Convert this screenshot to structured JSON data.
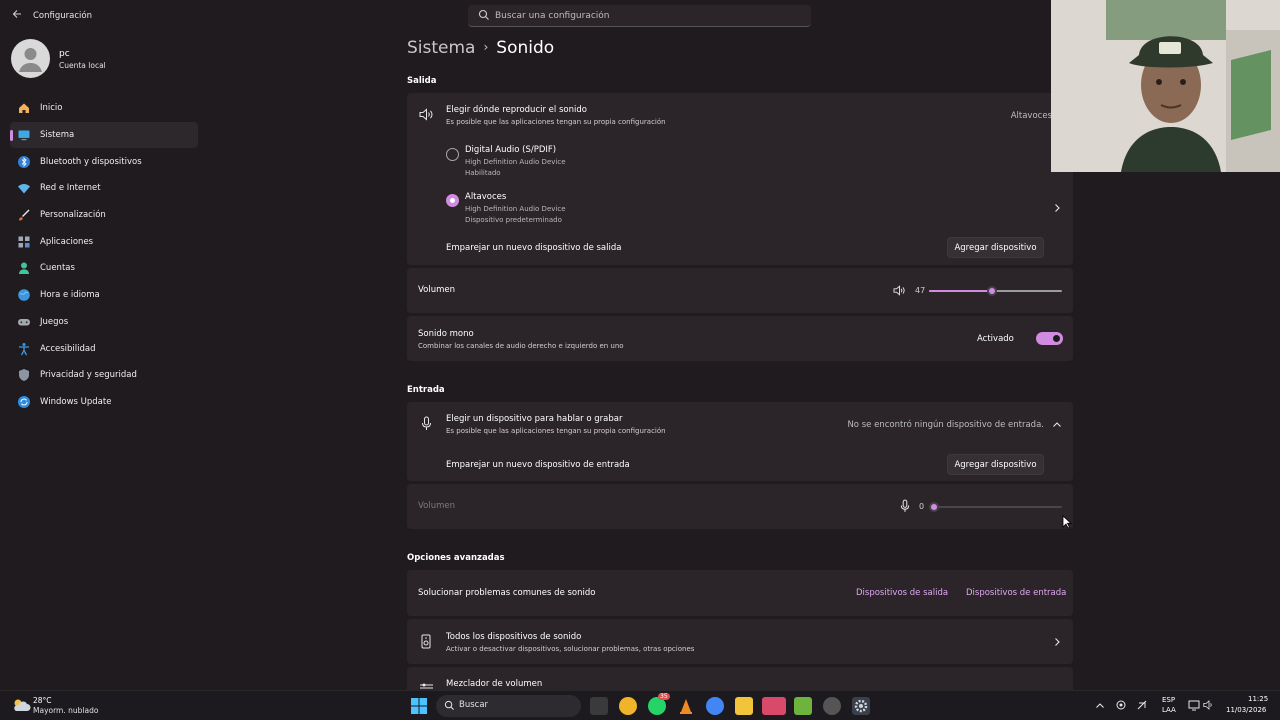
{
  "window": {
    "title": "Configuración"
  },
  "search": {
    "placeholder": "Buscar una configuración"
  },
  "profile": {
    "name": "pc",
    "account_type": "Cuenta local"
  },
  "sidebar": {
    "items": [
      {
        "label": "Inicio",
        "icon": "home-icon"
      },
      {
        "label": "Sistema",
        "icon": "system-icon",
        "active": true
      },
      {
        "label": "Bluetooth y dispositivos",
        "icon": "bluetooth-icon"
      },
      {
        "label": "Red e Internet",
        "icon": "wifi-icon"
      },
      {
        "label": "Personalización",
        "icon": "brush-icon"
      },
      {
        "label": "Aplicaciones",
        "icon": "apps-icon"
      },
      {
        "label": "Cuentas",
        "icon": "accounts-icon"
      },
      {
        "label": "Hora e idioma",
        "icon": "globe-icon"
      },
      {
        "label": "Juegos",
        "icon": "gamepad-icon"
      },
      {
        "label": "Accesibilidad",
        "icon": "accessibility-icon"
      },
      {
        "label": "Privacidad y seguridad",
        "icon": "shield-icon"
      },
      {
        "label": "Windows Update",
        "icon": "update-icon"
      }
    ]
  },
  "breadcrumb": {
    "parent": "Sistema",
    "separator": "›",
    "current": "Sonido"
  },
  "output": {
    "section_title": "Salida",
    "choose": {
      "title": "Elegir dónde reproducir el sonido",
      "subtitle": "Es posible que las aplicaciones tengan su propia configuración",
      "value": "Altavoces"
    },
    "devices": [
      {
        "name": "Digital Audio (S/PDIF)",
        "driver": "High Definition Audio Device",
        "status": "Habilitado",
        "selected": false
      },
      {
        "name": "Altavoces",
        "driver": "High Definition Audio Device",
        "status": "Dispositivo predeterminado",
        "selected": true
      }
    ],
    "pair": {
      "label": "Emparejar un nuevo dispositivo de salida",
      "button": "Agregar dispositivo"
    },
    "volume": {
      "label": "Volumen",
      "value": "47",
      "level": 47
    },
    "mono": {
      "title": "Sonido mono",
      "subtitle": "Combinar los canales de audio derecho e izquierdo en uno",
      "state": "Activado",
      "on": true
    }
  },
  "input": {
    "section_title": "Entrada",
    "choose": {
      "title": "Elegir un dispositivo para hablar o grabar",
      "subtitle": "Es posible que las aplicaciones tengan su propia configuración",
      "value": "No se encontró ningún dispositivo de entrada."
    },
    "pair": {
      "label": "Emparejar un nuevo dispositivo de entrada",
      "button": "Agregar dispositivo"
    },
    "volume": {
      "label": "Volumen",
      "value": "0",
      "level": 0
    }
  },
  "advanced": {
    "section_title": "Opciones avanzadas",
    "troubleshoot": {
      "label": "Solucionar problemas comunes de sonido",
      "link_output": "Dispositivos de salida",
      "link_input": "Dispositivos de entrada"
    },
    "all_devices": {
      "title": "Todos los dispositivos de sonido",
      "subtitle": "Activar o desactivar dispositivos, solucionar problemas, otras opciones"
    },
    "mixer": {
      "title": "Mezclador de volumen"
    }
  },
  "taskbar": {
    "temperature": "28°C",
    "weather": "Mayorm. nublado",
    "search_label": "Buscar",
    "whatsapp_badge": "35",
    "lang_top": "ESP",
    "lang_bottom": "LAA",
    "time": "11:25",
    "date": "11/03/2026"
  },
  "colors": {
    "accent": "#d18be0",
    "background": "#201b1f",
    "card": "#2b2529"
  }
}
